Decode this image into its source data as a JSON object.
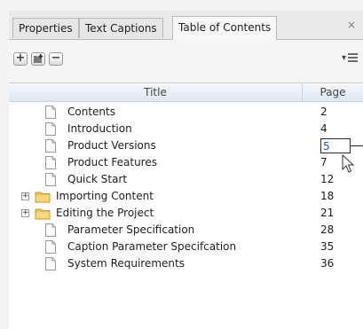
{
  "tabs": [
    {
      "label": "Properties",
      "active": false
    },
    {
      "label": "Text Captions",
      "active": false
    },
    {
      "label": "Table of Contents",
      "active": true
    }
  ],
  "close_glyph": "×",
  "toolbar": {
    "buttons": [
      {
        "icon": "plus-icon",
        "glyph": "+"
      },
      {
        "icon": "add-folder-icon",
        "glyph": ""
      },
      {
        "icon": "minus-icon",
        "glyph": "−"
      }
    ],
    "options_glyph": "▾"
  },
  "table": {
    "columns": {
      "title": "Title",
      "page": "Page"
    },
    "rows": [
      {
        "type": "document",
        "title": "Contents",
        "page": "2"
      },
      {
        "type": "document",
        "title": "Introduction",
        "page": "4"
      },
      {
        "type": "document",
        "title": "Product Versions",
        "page": "5",
        "editing": true
      },
      {
        "type": "document",
        "title": "Product Features",
        "page": "7"
      },
      {
        "type": "document",
        "title": "Quick Start",
        "page": "12"
      },
      {
        "type": "folder",
        "title": "Importing Content",
        "page": "18",
        "expander": "+"
      },
      {
        "type": "folder",
        "title": "Editing the Project",
        "page": "21",
        "expander": "+"
      },
      {
        "type": "document",
        "title": "Parameter Specification",
        "page": "28"
      },
      {
        "type": "document",
        "title": "Caption Parameter Specifcation",
        "page": "35"
      },
      {
        "type": "document",
        "title": "System Requirements",
        "page": "36"
      }
    ]
  },
  "colors": {
    "header": "#dde8f0",
    "edit_text": "#1a5bd6",
    "folder": "#f2c24f"
  }
}
